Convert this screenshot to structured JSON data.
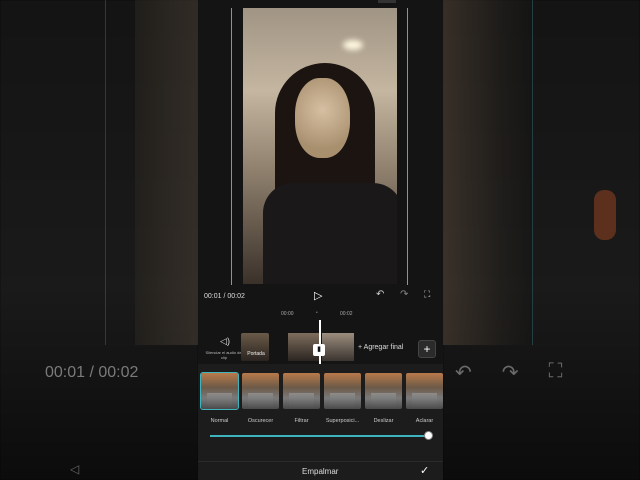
{
  "player": {
    "time_current": "00:01",
    "time_separator": "/",
    "time_total": "00:02",
    "time_display": "00:01 / 00:02"
  },
  "ruler": {
    "tick_start": "00:00",
    "tick_end": "00:02"
  },
  "timeline": {
    "mute_label": "Silenciar el audio del clip",
    "cover_label": "Portada",
    "add_final_label": "+ Agregar final"
  },
  "transitions": {
    "options": [
      {
        "label": "Normal",
        "selected": true
      },
      {
        "label": "Oscurecer",
        "selected": false
      },
      {
        "label": "Filtrar",
        "selected": false
      },
      {
        "label": "Superposici...",
        "selected": false
      },
      {
        "label": "Deslizar",
        "selected": false
      },
      {
        "label": "Aclarar",
        "selected": false
      }
    ],
    "slider_value": 1.0,
    "title": "Empalmar"
  },
  "background": {
    "time_display": "00:01 / 00:02"
  },
  "colors": {
    "accent": "#3fb4bf",
    "panel": "#1c1c1c",
    "background": "#000000"
  }
}
